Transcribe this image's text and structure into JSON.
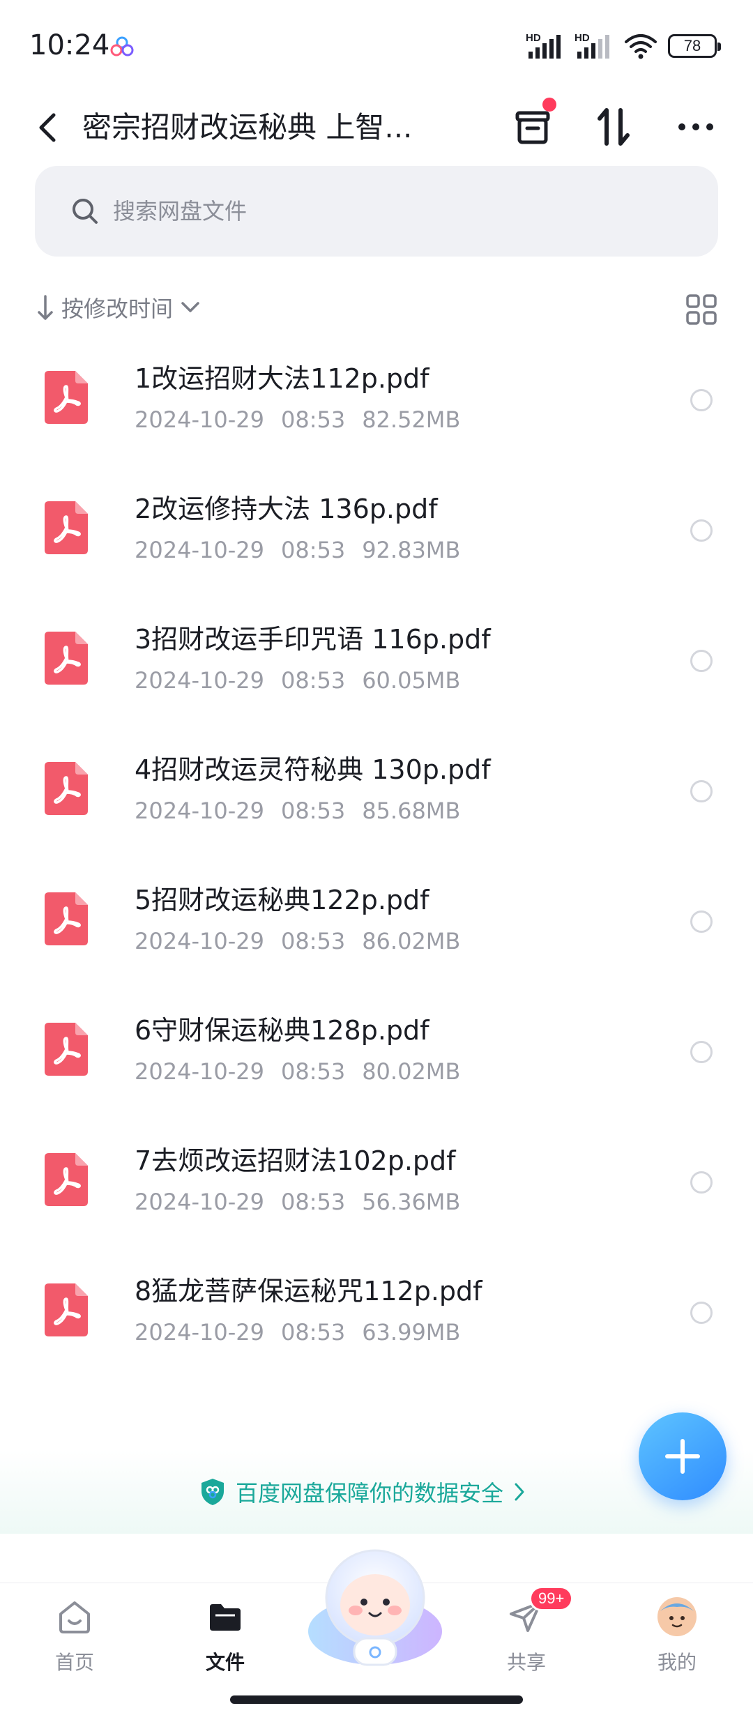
{
  "status_bar": {
    "time": "10:24",
    "signal_1_label": "HD",
    "signal_2_label": "HD",
    "battery": "78"
  },
  "header": {
    "title": "密宗招财改运秘典 上智...",
    "has_notification_dot": true
  },
  "search": {
    "placeholder": "搜索网盘文件"
  },
  "sort": {
    "label": "按修改时间"
  },
  "files": [
    {
      "name": "1改运招财大法112p.pdf",
      "date": "2024-10-29",
      "time": "08:53",
      "size": "82.52MB"
    },
    {
      "name": "2改运修持大法 136p.pdf",
      "date": "2024-10-29",
      "time": "08:53",
      "size": "92.83MB"
    },
    {
      "name": "3招财改运手印咒语 116p.pdf",
      "date": "2024-10-29",
      "time": "08:53",
      "size": "60.05MB"
    },
    {
      "name": "4招财改运灵符秘典  130p.pdf",
      "date": "2024-10-29",
      "time": "08:53",
      "size": "85.68MB"
    },
    {
      "name": "5招财改运秘典122p.pdf",
      "date": "2024-10-29",
      "time": "08:53",
      "size": "86.02MB"
    },
    {
      "name": "6守财保运秘典128p.pdf",
      "date": "2024-10-29",
      "time": "08:53",
      "size": "80.02MB"
    },
    {
      "name": "7去烦改运招财法102p.pdf",
      "date": "2024-10-29",
      "time": "08:53",
      "size": "56.36MB"
    },
    {
      "name": "8猛龙菩萨保运秘咒112p.pdf",
      "date": "2024-10-29",
      "time": "08:53",
      "size": "63.99MB"
    }
  ],
  "banner": {
    "text": "百度网盘保障你的数据安全"
  },
  "nav": {
    "home": "首页",
    "files": "文件",
    "share": "共享",
    "share_badge": "99+",
    "me": "我的"
  },
  "colors": {
    "pdf_red": "#f25a6b",
    "accent_blue": "#2f8cff",
    "security_green": "#1aa89a",
    "badge_red": "#ff3b5c"
  }
}
